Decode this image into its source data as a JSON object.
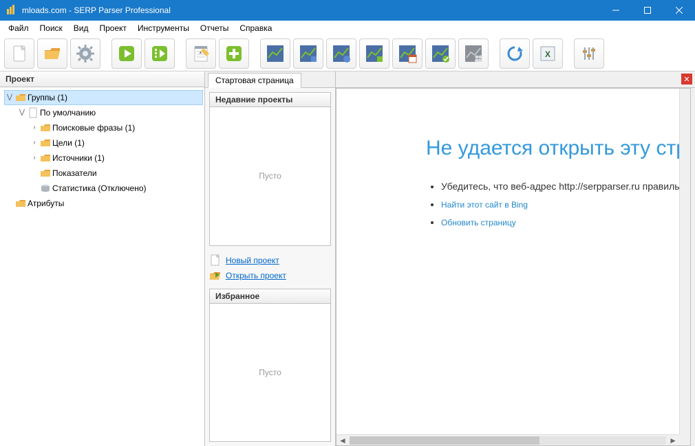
{
  "title": "mloads.com - SERP Parser Professional",
  "menu": [
    "Файл",
    "Поиск",
    "Вид",
    "Проект",
    "Инструменты",
    "Отчеты",
    "Справка"
  ],
  "toolbar_icons": [
    "new-file-icon",
    "open-folder-icon",
    "settings-gear-icon",
    "play-icon",
    "play-list-icon",
    "notepad-icon",
    "plus-icon",
    "chart-positions-icon",
    "chart-blue-2-icon",
    "chart-blue-3-icon",
    "chart-green-1-icon",
    "chart-calendar-icon",
    "chart-green-check-icon",
    "chart-users-icon",
    "refresh-icon",
    "export-excel-icon",
    "equalizer-icon"
  ],
  "panels": {
    "project": "Проект",
    "tree": {
      "groups": "Группы (1)",
      "default": "По умолчанию",
      "phrases": "Поисковые фразы (1)",
      "goals": "Цели (1)",
      "sources": "Источники (1)",
      "indicators": "Показатели",
      "stats": "Статистика (Отключено)",
      "attributes": "Атрибуты"
    }
  },
  "tabs": {
    "start": "Стартовая страница"
  },
  "recent": {
    "header": "Недавние проекты",
    "empty": "Пусто"
  },
  "favorites": {
    "header": "Избранное",
    "empty": "Пусто"
  },
  "links": {
    "new_project": "Новый проект",
    "open_project": "Открыть проект"
  },
  "error_page": {
    "heading": "Не удается открыть эту страницу",
    "line1": "Убедитесь, что веб-адрес http://serpparser.ru правильный",
    "link_bing": "Найти этот сайт в Bing",
    "link_refresh": "Обновить страницу"
  }
}
